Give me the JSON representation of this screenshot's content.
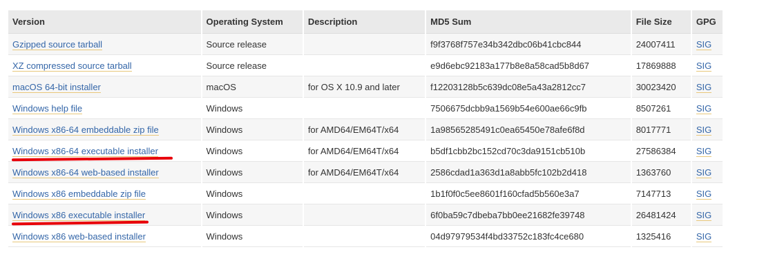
{
  "table": {
    "headers": {
      "version": "Version",
      "os": "Operating System",
      "description": "Description",
      "md5": "MD5 Sum",
      "size": "File Size",
      "gpg": "GPG"
    },
    "rows": [
      {
        "version": "Gzipped source tarball",
        "os": "Source release",
        "description": "",
        "md5": "f9f3768f757e34b342dbc06b41cbc844",
        "size": "24007411",
        "gpg": "SIG"
      },
      {
        "version": "XZ compressed source tarball",
        "os": "Source release",
        "description": "",
        "md5": "e9d6ebc92183a177b8e8a58cad5b8d67",
        "size": "17869888",
        "gpg": "SIG"
      },
      {
        "version": "macOS 64-bit installer",
        "os": "macOS",
        "description": "for OS X 10.9 and later",
        "md5": "f12203128b5c639dc08e5a43a2812cc7",
        "size": "30023420",
        "gpg": "SIG"
      },
      {
        "version": "Windows help file",
        "os": "Windows",
        "description": "",
        "md5": "7506675dcbb9a1569b54e600ae66c9fb",
        "size": "8507261",
        "gpg": "SIG"
      },
      {
        "version": "Windows x86-64 embeddable zip file",
        "os": "Windows",
        "description": "for AMD64/EM64T/x64",
        "md5": "1a98565285491c0ea65450e78afe6f8d",
        "size": "8017771",
        "gpg": "SIG"
      },
      {
        "version": "Windows x86-64 executable installer",
        "os": "Windows",
        "description": "for AMD64/EM64T/x64",
        "md5": "b5df1cbb2bc152cd70c3da9151cb510b",
        "size": "27586384",
        "gpg": "SIG"
      },
      {
        "version": "Windows x86-64 web-based installer",
        "os": "Windows",
        "description": "for AMD64/EM64T/x64",
        "md5": "2586cdad1a363d1a8abb5fc102b2d418",
        "size": "1363760",
        "gpg": "SIG"
      },
      {
        "version": "Windows x86 embeddable zip file",
        "os": "Windows",
        "description": "",
        "md5": "1b1f0f0c5ee8601f160cfad5b560e3a7",
        "size": "7147713",
        "gpg": "SIG"
      },
      {
        "version": "Windows x86 executable installer",
        "os": "Windows",
        "description": "",
        "md5": "6f0ba59c7dbeba7bb0ee21682fe39748",
        "size": "26481424",
        "gpg": "SIG"
      },
      {
        "version": "Windows x86 web-based installer",
        "os": "Windows",
        "description": "",
        "md5": "04d97979534f4bd33752c183fc4ce680",
        "size": "1325416",
        "gpg": "SIG"
      }
    ]
  },
  "colors": {
    "link": "#3466a8",
    "link_underline": "#e8c77a",
    "header_bg": "#eaeaea",
    "row_alt_bg": "#f6f6f6",
    "annotation": "#e8000a"
  }
}
